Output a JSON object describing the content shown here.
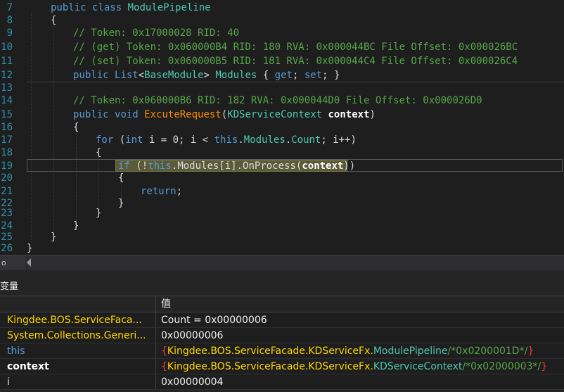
{
  "editor": {
    "lines": [
      {
        "num": "7"
      },
      {
        "num": "8"
      },
      {
        "num": "9"
      },
      {
        "num": "10"
      },
      {
        "num": "11"
      },
      {
        "num": "12"
      },
      {
        "num": "13"
      },
      {
        "num": "14"
      },
      {
        "num": "15"
      },
      {
        "num": "16"
      },
      {
        "num": "17"
      },
      {
        "num": "18"
      },
      {
        "num": "19"
      },
      {
        "num": "20"
      },
      {
        "num": "21"
      },
      {
        "num": "22"
      },
      {
        "num": "23"
      },
      {
        "num": "24"
      },
      {
        "num": "25"
      },
      {
        "num": "26"
      }
    ],
    "t": {
      "public": "public",
      "class": "class",
      "classname": " ModulePipeline",
      "brace_open": "{",
      "brace_close": "}",
      "c9": "// Token: 0x17000028 RID: 40",
      "c10": "// (get) Token: 0x060000B4 RID: 180 RVA: 0x000044BC File Offset: 0x000026BC",
      "c11": "// (set) Token: 0x060000B5 RID: 181 RVA: 0x000044C4 File Offset: 0x000026C4",
      "list": "List",
      "lt": "<",
      "basemodule": "BaseModule",
      "gt": ">",
      "modules": "Modules",
      "getset_a": " { ",
      "get": "get",
      "semi_sp": "; ",
      "set": "set",
      "getset_b": "; }",
      "c14": "// Token: 0x060000B6 RID: 182 RVA: 0x000044D0 File Offset: 0x000026D0",
      "void": "void",
      "execname": "ExcuteRequest",
      "paren_open": "(",
      "ctxtype": "KDServiceContext",
      "context": "context",
      "paren_close": ")",
      "for": "for",
      "for_a": " (",
      "int": "int",
      "for_b": " i = 0; i < ",
      "this": "this",
      "dot": ".",
      "count": "Count",
      "for_c": "; i++)",
      "if": "if",
      "if_a": " (!",
      "modules_idx": "Modules[i]",
      "dot_onprocess": ".OnProcess",
      "return": "return",
      "semicolon": ";"
    }
  },
  "statusbar": {
    "zoom": "o"
  },
  "panel": {
    "title": "变量",
    "header_value": "值",
    "rows": [
      {
        "name": "Kingdee.BOS.ServiceFaca...",
        "value": "Count = 0x00000006"
      },
      {
        "name": "System.Collections.Generi...",
        "value": "0x00000006"
      },
      {
        "name": "this",
        "v_open": "{",
        "v_ns": "Kingdee.BOS.ServiceFacade.KDServiceFx.",
        "v_type": "ModulePipeline",
        "v_token": "/*0x0200001D*/",
        "v_close": "}"
      },
      {
        "name": "context",
        "v_open": "{",
        "v_ns": "Kingdee.BOS.ServiceFacade.KDServiceFx.",
        "v_type": "KDServiceContext",
        "v_token": "/*0x02000003*/",
        "v_close": "}"
      },
      {
        "name": "i",
        "value": "0x00000004"
      }
    ]
  },
  "colors": {
    "bg": "#1e1e1e",
    "keyword": "#569cd6",
    "comment": "#57a64a",
    "type": "#4ec9b0",
    "method": "#ff8c00",
    "linenum": "#2b91af",
    "highlight": "#5b5b3a",
    "name_yellow": "#ffd700",
    "brace_red": "#ff3333"
  }
}
